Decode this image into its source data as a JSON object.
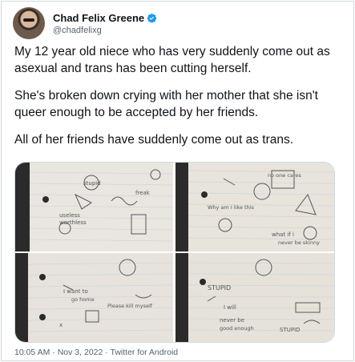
{
  "author": {
    "display_name": "Chad Felix Greene",
    "handle": "@chadfelixg",
    "verified_icon": "verified-badge-icon",
    "accent_color": "#1d9bf0"
  },
  "tweet": {
    "paragraphs": [
      "My 12 year old niece who has very suddenly come out as asexual and trans has been cutting herself.",
      "She's broken down crying with her mother that she isn't queer enough to be accepted by her friends.",
      "All of her friends have suddenly come out as trans."
    ]
  },
  "media": {
    "photo_count": 4,
    "photos": [
      {
        "scribbles": [
          "stupid",
          "freak",
          "useless",
          "worthless"
        ]
      },
      {
        "scribbles": [
          "no one cares",
          "Why am I like this",
          "what if i",
          "never be skinny"
        ]
      },
      {
        "scribbles": [
          "I want to",
          "go home",
          "Please kill myself",
          "x"
        ]
      },
      {
        "scribbles": [
          "STUPID",
          "I will",
          "never be",
          "good enough",
          "STUPID"
        ]
      }
    ]
  },
  "meta": {
    "time": "10:05 AM",
    "separator": " · ",
    "date": "Nov 3, 2022",
    "source": "Twitter for Android"
  }
}
